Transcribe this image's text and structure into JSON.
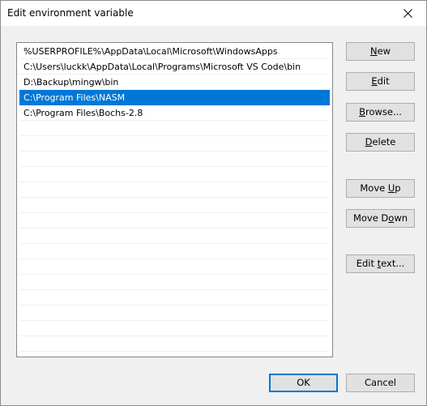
{
  "window": {
    "title": "Edit environment variable",
    "close_icon": "close-icon"
  },
  "paths": [
    "%USERPROFILE%\\AppData\\Local\\Microsoft\\WindowsApps",
    "C:\\Users\\luckk\\AppData\\Local\\Programs\\Microsoft VS Code\\bin",
    "D:\\Backup\\mingw\\bin",
    "C:\\Program Files\\NASM",
    "C:\\Program Files\\Bochs-2.8"
  ],
  "selected_index": 3,
  "buttons": {
    "new": {
      "pre": "",
      "accel": "N",
      "post": "ew"
    },
    "edit": {
      "pre": "",
      "accel": "E",
      "post": "dit"
    },
    "browse": {
      "pre": "",
      "accel": "B",
      "post": "rowse..."
    },
    "delete": {
      "pre": "",
      "accel": "D",
      "post": "elete"
    },
    "move_up": {
      "pre": "Move ",
      "accel": "U",
      "post": "p"
    },
    "move_down": {
      "pre": "Move D",
      "accel": "o",
      "post": "wn"
    },
    "edit_text": {
      "pre": "Edit ",
      "accel": "t",
      "post": "ext..."
    },
    "ok": "OK",
    "cancel": "Cancel"
  },
  "colors": {
    "selection": "#0078d7",
    "default_button_border": "#0078d7"
  }
}
